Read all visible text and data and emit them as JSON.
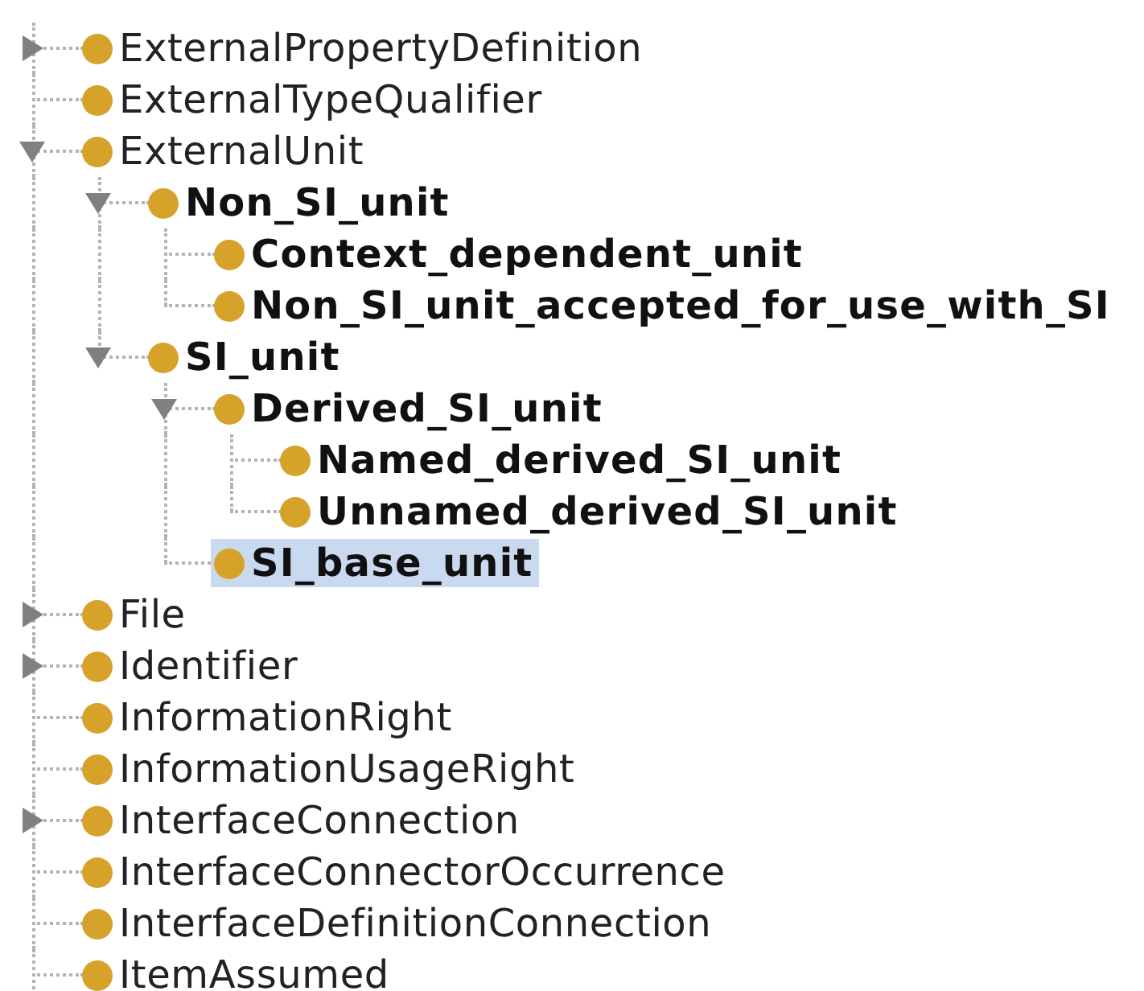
{
  "tree": [
    {
      "label": "ExternalPropertyDefinition",
      "kind": "branch",
      "expanded": false,
      "bold": false,
      "selected": false
    },
    {
      "label": "ExternalTypeQualifier",
      "kind": "leaf",
      "bold": false,
      "selected": false
    },
    {
      "label": "ExternalUnit",
      "kind": "branch",
      "expanded": true,
      "bold": false,
      "selected": false,
      "children": [
        {
          "label": "Non_SI_unit",
          "kind": "branch",
          "expanded": true,
          "bold": true,
          "selected": false,
          "children": [
            {
              "label": "Context_dependent_unit",
              "kind": "leaf",
              "bold": true,
              "selected": false
            },
            {
              "label": "Non_SI_unit_accepted_for_use_with_SI",
              "kind": "leaf",
              "bold": true,
              "selected": false
            }
          ]
        },
        {
          "label": "SI_unit",
          "kind": "branch",
          "expanded": true,
          "bold": true,
          "selected": false,
          "children": [
            {
              "label": "Derived_SI_unit",
              "kind": "branch",
              "expanded": true,
              "bold": true,
              "selected": false,
              "children": [
                {
                  "label": "Named_derived_SI_unit",
                  "kind": "leaf",
                  "bold": true,
                  "selected": false
                },
                {
                  "label": "Unnamed_derived_SI_unit",
                  "kind": "leaf",
                  "bold": true,
                  "selected": false
                }
              ]
            },
            {
              "label": "SI_base_unit",
              "kind": "leaf",
              "bold": true,
              "selected": true
            }
          ]
        }
      ]
    },
    {
      "label": "File",
      "kind": "branch",
      "expanded": false,
      "bold": false,
      "selected": false
    },
    {
      "label": "Identifier",
      "kind": "branch",
      "expanded": false,
      "bold": false,
      "selected": false
    },
    {
      "label": "InformationRight",
      "kind": "leaf",
      "bold": false,
      "selected": false
    },
    {
      "label": "InformationUsageRight",
      "kind": "leaf",
      "bold": false,
      "selected": false
    },
    {
      "label": "InterfaceConnection",
      "kind": "branch",
      "expanded": false,
      "bold": false,
      "selected": false
    },
    {
      "label": "InterfaceConnectorOccurrence",
      "kind": "leaf",
      "bold": false,
      "selected": false
    },
    {
      "label": "InterfaceDefinitionConnection",
      "kind": "leaf",
      "bold": false,
      "selected": false
    },
    {
      "label": "ItemAssumed",
      "kind": "leaf",
      "bold": false,
      "selected": false
    }
  ]
}
